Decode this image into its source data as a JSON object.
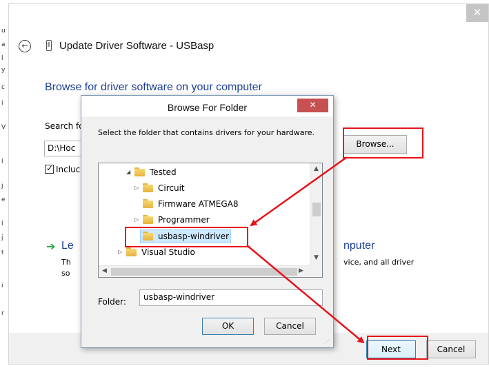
{
  "background_window": {
    "edge_chars": [
      "u",
      "a",
      "l",
      "y",
      "c",
      "i",
      "V",
      "l",
      "j",
      "e",
      "l",
      "j",
      "t",
      "i",
      "r"
    ]
  },
  "wizard": {
    "title": "Update Driver Software - USBasp",
    "heading": "Browse for driver software on your computer",
    "search_label": "Search fo",
    "path_value": "D:\\Hoc",
    "include_label": "Incluc",
    "browse_label": "Browse...",
    "option_title_start": "Le",
    "option_title_end": "nputer",
    "option_line1_start": "Th",
    "option_line1_end": "vice, and all driver",
    "option_line2_start": "so",
    "next_label": "Next",
    "cancel_label": "Cancel"
  },
  "dialog": {
    "title": "Browse For Folder",
    "instruction": "Select the folder that contains drivers for your hardware.",
    "tree": [
      {
        "label": "Tested",
        "expanded": true
      },
      {
        "label": "Circuit",
        "expanded": false
      },
      {
        "label": "Firmware ATMEGA8"
      },
      {
        "label": "Programmer",
        "expanded": false
      },
      {
        "label": "usbasp-windriver",
        "selected": true
      },
      {
        "label": "Visual Studio",
        "expanded": false
      }
    ],
    "folder_label": "Folder:",
    "folder_value": "usbasp-windriver",
    "ok_label": "OK",
    "cancel_label": "Cancel"
  },
  "colors": {
    "annotation": "#e8111a",
    "heading_blue": "#1c3f94",
    "selection": "#cde8ff",
    "close_red": "#c75050"
  }
}
